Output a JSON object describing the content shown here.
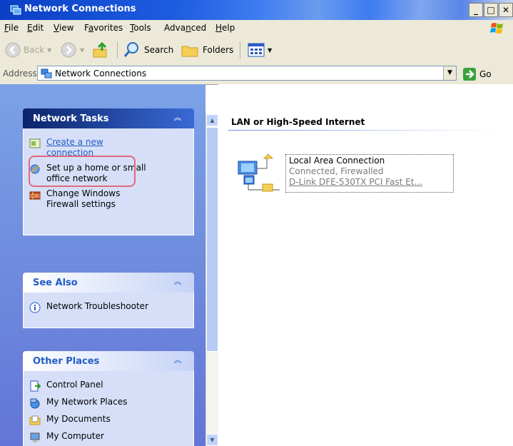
{
  "window": {
    "title": "Network Connections",
    "controls": [
      "minimize",
      "maximize",
      "close"
    ]
  },
  "menu": [
    {
      "label": "File",
      "mnemonic": "F"
    },
    {
      "label": "Edit",
      "mnemonic": "E"
    },
    {
      "label": "View",
      "mnemonic": "V"
    },
    {
      "label": "Favorites",
      "mnemonic": "a"
    },
    {
      "label": "Tools",
      "mnemonic": "T"
    },
    {
      "label": "Advanced",
      "mnemonic": "n"
    },
    {
      "label": "Help",
      "mnemonic": "H"
    }
  ],
  "toolbar": {
    "back_label": "Back",
    "search_label": "Search",
    "folders_label": "Folders",
    "views_icon": "views-icon"
  },
  "address": {
    "label": "Address",
    "value": "Network Connections",
    "go_label": "Go"
  },
  "sidebar": {
    "network_tasks": {
      "title": "Network Tasks",
      "items": [
        {
          "label_line1": "Create a new",
          "label_line2": "connection",
          "icon": "new-connection-icon",
          "highlighted": true
        },
        {
          "label_line1": "Set up a home or small",
          "label_line2": "office network",
          "icon": "home-network-icon"
        },
        {
          "label_line1": "Change Windows",
          "label_line2": "Firewall settings",
          "icon": "firewall-icon"
        }
      ]
    },
    "see_also": {
      "title": "See Also",
      "items": [
        {
          "label": "Network Troubleshooter",
          "icon": "info-icon"
        }
      ]
    },
    "other_places": {
      "title": "Other Places",
      "items": [
        {
          "label": "Control Panel",
          "icon": "control-panel-icon"
        },
        {
          "label": "My Network Places",
          "icon": "network-places-icon"
        },
        {
          "label": "My Documents",
          "icon": "documents-icon"
        },
        {
          "label": "My Computer",
          "icon": "computer-icon"
        }
      ]
    }
  },
  "content": {
    "group_title": "LAN or High-Speed Internet",
    "connection": {
      "name": "Local Area Connection",
      "status": "Connected, Firewalled",
      "device": "D-Link DFE-530TX PCI Fast Et..."
    }
  },
  "colors": {
    "titlebar": "#1e5ee0",
    "sidebar_bg": "#7ba2e7",
    "panel_body": "#d6dff7",
    "link": "#215dc6",
    "highlight": "#e06a7a"
  }
}
